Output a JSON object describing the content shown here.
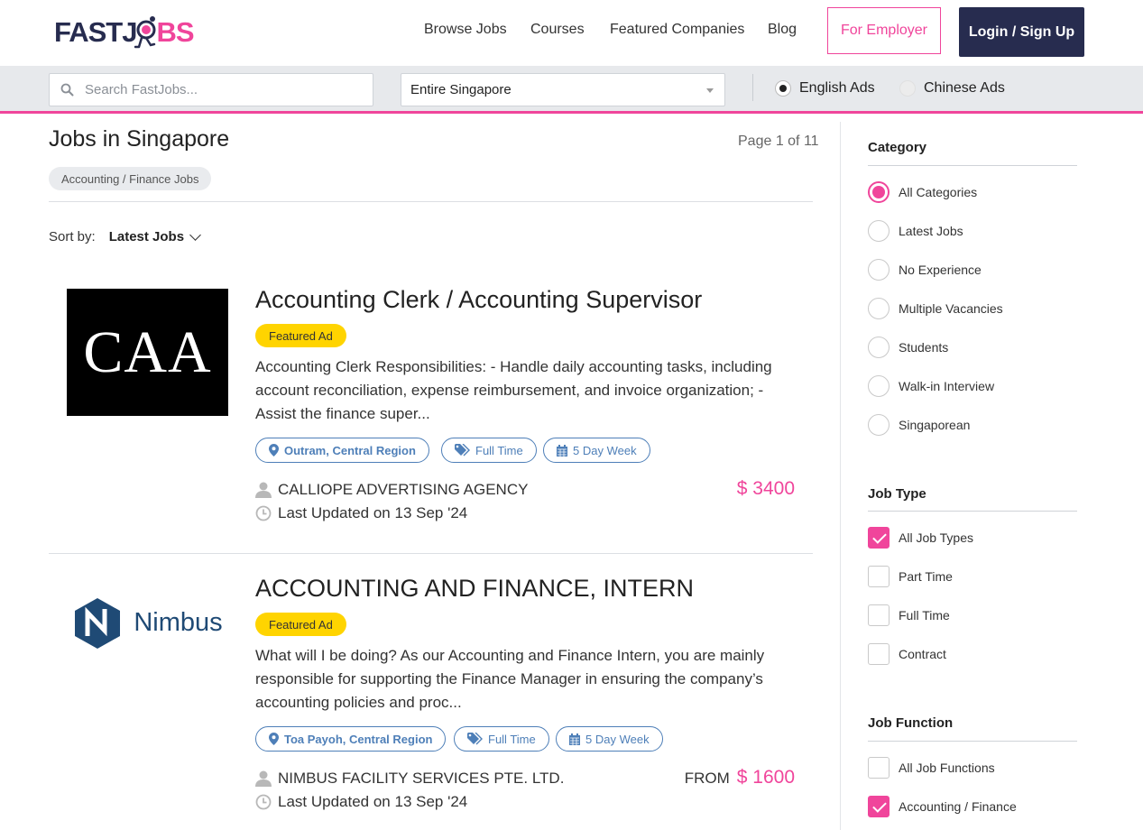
{
  "header": {
    "logo_fast": "FAST",
    "logo_j": "J",
    "logo_bs": "BS",
    "nav": [
      "Browse Jobs",
      "Courses",
      "Featured Companies",
      "Blog"
    ],
    "employer_label": "For Employer",
    "login_label": "Login / Sign Up"
  },
  "search": {
    "placeholder": "Search FastJobs...",
    "location": "Entire Singapore",
    "languages": [
      {
        "label": "English Ads",
        "selected": true
      },
      {
        "label": "Chinese Ads",
        "selected": false
      }
    ]
  },
  "main": {
    "title": "Jobs in Singapore",
    "page_info": "Page 1 of 11",
    "filter_chip": "Accounting / Finance Jobs",
    "sort_label": "Sort by:",
    "sort_value": "Latest Jobs"
  },
  "jobs": [
    {
      "logo_text": "CAA",
      "title": "Accounting Clerk / Accounting Supervisor",
      "badge": "Featured Ad",
      "description": "Accounting Clerk Responsibilities: - Handle daily accounting tasks, including account reconciliation, expense reimbursement, and invoice organization; - Assist the finance super...",
      "location": "Outram, Central Region",
      "job_type": "Full Time",
      "schedule": "5 Day Week",
      "company": "CALLIOPE ADVERTISING AGENCY",
      "updated": "Last Updated on 13 Sep '24",
      "salary_prefix": "",
      "salary": "$ 3400"
    },
    {
      "logo_text": "Nimbus",
      "title": "ACCOUNTING AND FINANCE, INTERN",
      "badge": "Featured Ad",
      "description": "What will I be doing? As our Accounting and Finance Intern, you are mainly responsible for supporting the Finance Manager in ensuring the company’s accounting policies and proc...",
      "location": "Toa Payoh, Central Region",
      "job_type": "Full Time",
      "schedule": "5 Day Week",
      "company": "NIMBUS FACILITY SERVICES PTE. LTD.",
      "updated": "Last Updated on 13 Sep '24",
      "salary_prefix": "FROM",
      "salary": "$ 1600"
    }
  ],
  "sidebar": {
    "category_title": "Category",
    "categories": [
      {
        "label": "All Categories",
        "selected": true
      },
      {
        "label": "Latest Jobs",
        "selected": false
      },
      {
        "label": "No Experience",
        "selected": false
      },
      {
        "label": "Multiple Vacancies",
        "selected": false
      },
      {
        "label": "Students",
        "selected": false
      },
      {
        "label": "Walk-in Interview",
        "selected": false
      },
      {
        "label": "Singaporean",
        "selected": false
      }
    ],
    "jobtype_title": "Job Type",
    "job_types": [
      {
        "label": "All Job Types",
        "checked": true
      },
      {
        "label": "Part Time",
        "checked": false
      },
      {
        "label": "Full Time",
        "checked": false
      },
      {
        "label": "Contract",
        "checked": false
      }
    ],
    "jobfunction_title": "Job Function",
    "job_functions": [
      {
        "label": "All Job Functions",
        "checked": false
      },
      {
        "label": "Accounting / Finance",
        "checked": true
      }
    ]
  },
  "colors": {
    "brand_pink": "#f0459b",
    "brand_navy": "#272c4f",
    "tag_blue": "#4e7fb8",
    "featured_yellow": "#ffd400"
  }
}
